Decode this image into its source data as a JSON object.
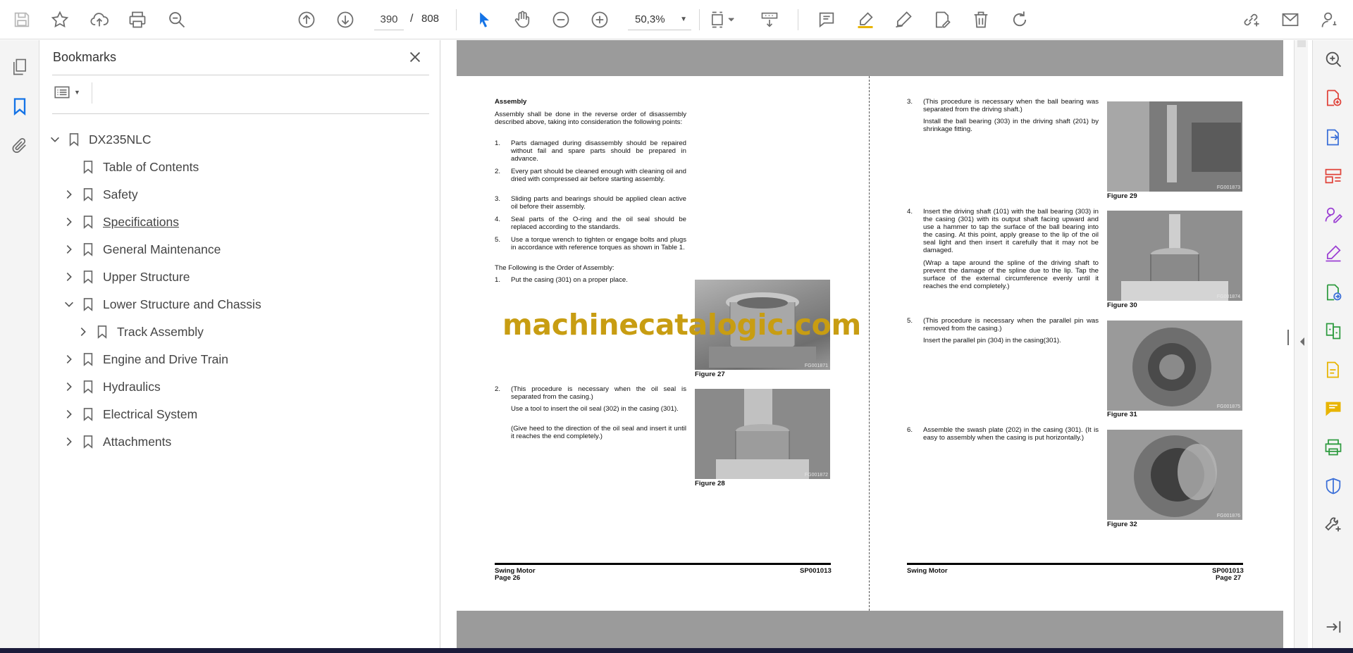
{
  "toolbar": {
    "current_page": "390",
    "page_separator": "/",
    "total_pages": "808",
    "zoom": "50,3%"
  },
  "bookmarks_panel": {
    "title": "Bookmarks",
    "items": [
      {
        "label": "DX235NLC",
        "level": 0,
        "state": "expanded"
      },
      {
        "label": "Table of Contents",
        "level": 1,
        "state": "leaf"
      },
      {
        "label": "Safety",
        "level": 1,
        "state": "collapsed"
      },
      {
        "label": "Specifications",
        "level": 1,
        "state": "collapsed"
      },
      {
        "label": "General Maintenance",
        "level": 1,
        "state": "collapsed"
      },
      {
        "label": "Upper Structure",
        "level": 1,
        "state": "collapsed"
      },
      {
        "label": "Lower Structure and Chassis",
        "level": 1,
        "state": "expanded"
      },
      {
        "label": "Track Assembly",
        "level": 2,
        "state": "collapsed"
      },
      {
        "label": "Engine and Drive Train",
        "level": 1,
        "state": "collapsed"
      },
      {
        "label": "Hydraulics",
        "level": 1,
        "state": "collapsed"
      },
      {
        "label": "Electrical System",
        "level": 1,
        "state": "collapsed"
      },
      {
        "label": "Attachments",
        "level": 1,
        "state": "collapsed"
      }
    ]
  },
  "document": {
    "left_page": {
      "heading": "Assembly",
      "intro": "Assembly shall be done in the reverse order of disassembly described above, taking into consideration the following points:",
      "points": [
        {
          "num": "1.",
          "text": "Parts damaged during disassembly should be repaired without fail and spare parts should be prepared in advance."
        },
        {
          "num": "2.",
          "text": "Every part should be cleaned enough with cleaning oil and dried with compressed air before starting assembly."
        },
        {
          "num": "3.",
          "text": "Sliding parts and bearings should be applied clean active oil before their assembly."
        },
        {
          "num": "4.",
          "text": "Seal parts of the O-ring and the oil seal should be replaced according to the standards."
        },
        {
          "num": "5.",
          "text": "Use a torque wrench to tighten or engage bolts and plugs in accordance with reference torques as shown in Table 1."
        }
      ],
      "order_heading": "The Following is the Order of Assembly:",
      "step1": {
        "num": "1.",
        "text": "Put the casing (301) on a proper place."
      },
      "step2": {
        "num": "2.",
        "text": "(This procedure is necessary when the oil seal is separated from the casing.)",
        "text2": "Use a tool to insert the oil seal (302) in the casing (301).",
        "text3": "(Give heed to the direction of the oil seal and insert it until it reaches the end completely.)"
      },
      "fig27": {
        "caption": "Figure 27",
        "code": "FG001871"
      },
      "fig28": {
        "caption": "Figure 28",
        "code": "FG001872"
      },
      "footer_left": "Swing Motor",
      "footer_page": "Page 26",
      "footer_right": "SP001013"
    },
    "right_page": {
      "step3": {
        "num": "3.",
        "text": "(This procedure is necessary when the ball bearing was separated from the driving shaft.)",
        "text2": "Install the ball bearing (303) in the driving shaft (201) by shrinkage fitting."
      },
      "step4": {
        "num": "4.",
        "text": "Insert the driving shaft (101) with the ball bearing (303) in the casing (301) with its output shaft facing upward and use a hammer to tap the surface of the ball bearing into the casing. At this point, apply grease to the lip of the oil seal light and then insert it carefully that it may not be damaged.",
        "text2": "(Wrap a tape around the spline of the driving shaft to prevent the damage of the spline due to the lip. Tap the surface of the external circumference evenly until it reaches the end completely.)"
      },
      "step5": {
        "num": "5.",
        "text": "(This procedure is necessary when the parallel pin was removed from the casing.)",
        "text2": "Insert the parallel pin (304) in the casing(301)."
      },
      "step6": {
        "num": "6.",
        "text": "Assemble the swash plate (202) in the casing (301). (It is easy to assembly when the casing is put horizontally.)"
      },
      "fig29": {
        "caption": "Figure 29",
        "code": "FG001873"
      },
      "fig30": {
        "caption": "Figure 30",
        "code": "FG001874"
      },
      "fig31": {
        "caption": "Figure 31",
        "code": "FG001875"
      },
      "fig32": {
        "caption": "Figure 32",
        "code": "FG001876"
      },
      "footer_left": "Swing Motor",
      "footer_page": "Page 27",
      "footer_right": "SP001013"
    },
    "watermark": "machinecatalogic.com"
  },
  "colors": {
    "accent_blue": "#1473e6",
    "icon_gray": "#6e6e6e",
    "rail_red": "#e0433a",
    "rail_blue": "#3b6fd8",
    "rail_purple": "#9b3fd3",
    "rail_green": "#2e9b3f",
    "rail_yellow": "#e8b400",
    "watermark": "#c89d12"
  }
}
